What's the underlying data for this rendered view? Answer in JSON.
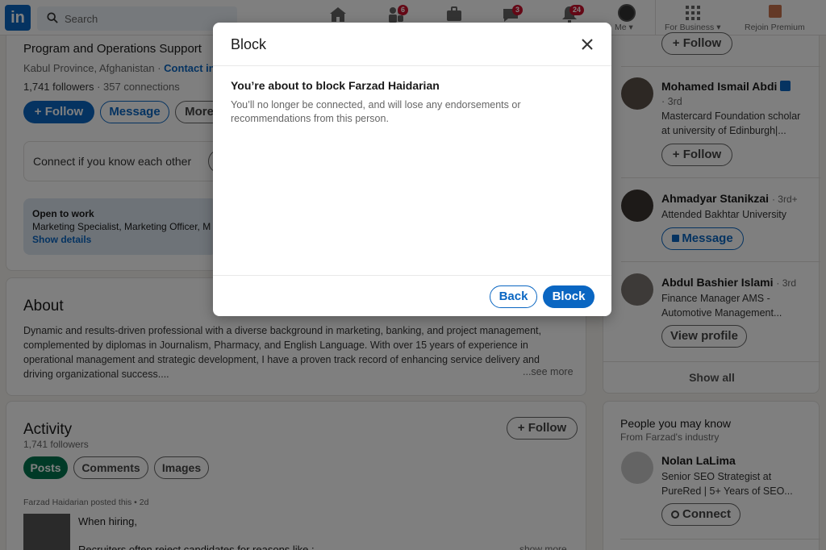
{
  "nav": {
    "logo_text": "in",
    "search_placeholder": "Search",
    "messaging_badge": "6",
    "notif_msg_badge": "3",
    "notifications_badge": "24",
    "me_label": "Me",
    "business_label": "For Business",
    "premium_label": "Rejoin Premium"
  },
  "profile": {
    "headline": "Program and Operations Support",
    "location": "Kabul Province, Afghanistan",
    "contact_info": "Contact info",
    "followers": "1,741 followers",
    "connections": "357 connections",
    "follow_label": "+ Follow",
    "message_label": "Message",
    "more_label": "More",
    "connect_prompt": "Connect if you know each other",
    "open_to_work_title": "Open to work",
    "open_to_work_roles": "Marketing Specialist, Marketing Officer, M",
    "show_details": "Show details"
  },
  "about": {
    "title": "About",
    "text": "Dynamic and results-driven professional with a diverse background in marketing, banking, and project management, complemented by diplomas in Journalism, Pharmacy, and English Language. With over 15 years of experience in operational management and strategic development, I have a proven track record of enhancing service delivery and driving organizational success....",
    "see_more": "...see more"
  },
  "activity": {
    "title": "Activity",
    "followers": "1,741 followers",
    "follow_label": "+ Follow",
    "tabs": [
      "Posts",
      "Comments",
      "Images"
    ],
    "post_meta": "Farzad Haidarian posted this • 2d",
    "post_line1": "When hiring,",
    "post_line2": "Recruiters often reject candidates for reasons like :",
    "post_show_more": "show more"
  },
  "sidebar": {
    "top_follow_label": "+ Follow",
    "people": [
      {
        "name": "Mohamed Ismail Abdi",
        "degree": "· 3rd",
        "desc": "Mastercard Foundation scholar at university of Edinburgh|...",
        "action": "+ Follow"
      },
      {
        "name": "Ahmadyar Stanikzai",
        "degree": "· 3rd+",
        "desc": "Attended Bakhtar University",
        "action": "Message"
      },
      {
        "name": "Abdul Bashier Islami",
        "degree": "· 3rd",
        "desc": "Finance Manager AMS - Automotive Management...",
        "action": "View profile"
      }
    ],
    "show_all": "Show all",
    "pymk_title": "People you may know",
    "pymk_subtitle": "From Farzad's industry",
    "pymk_person": {
      "name": "Nolan LaLima",
      "desc": "Senior SEO Strategist at PureRed | 5+ Years of SEO...",
      "action": "Connect"
    }
  },
  "modal": {
    "title": "Block",
    "subheading": "You’re about to block Farzad Haidarian",
    "message": "You’ll no longer be connected, and will lose any endorsements or recommendations from this person.",
    "back_label": "Back",
    "block_label": "Block"
  },
  "colors": {
    "brand": "#0a66c2",
    "active_tab": "#01754f",
    "badge": "#cb112d"
  }
}
